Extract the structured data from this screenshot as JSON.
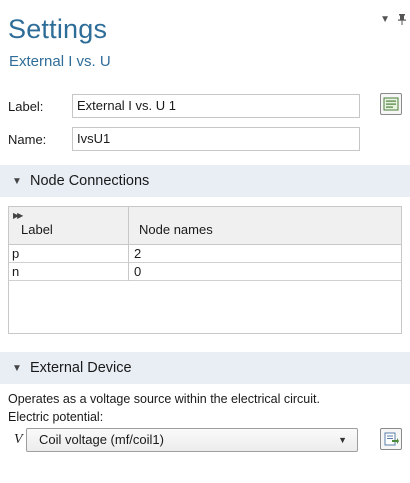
{
  "header": {
    "title": "Settings",
    "subtitle": "External I vs. U",
    "icon_menu": "chevron-down-icon",
    "icon_pin": "pin-icon"
  },
  "fields": {
    "label_caption": "Label:",
    "label_value": "External I vs. U 1",
    "name_caption": "Name:",
    "name_value": "IvsU1"
  },
  "node_connections": {
    "title": "Node Connections",
    "columns": [
      "Label",
      "Node names"
    ],
    "rows": [
      {
        "label": "p",
        "node": "2"
      },
      {
        "label": "n",
        "node": "0"
      }
    ]
  },
  "external_device": {
    "title": "External Device",
    "description": "Operates as a voltage source within the electrical circuit.",
    "potential_label": "Electric potential:",
    "variable": "V",
    "selected": "Coil voltage (mf/coil1)"
  },
  "colors": {
    "accent": "#2f6d99",
    "section_bg": "#e9eef5"
  }
}
